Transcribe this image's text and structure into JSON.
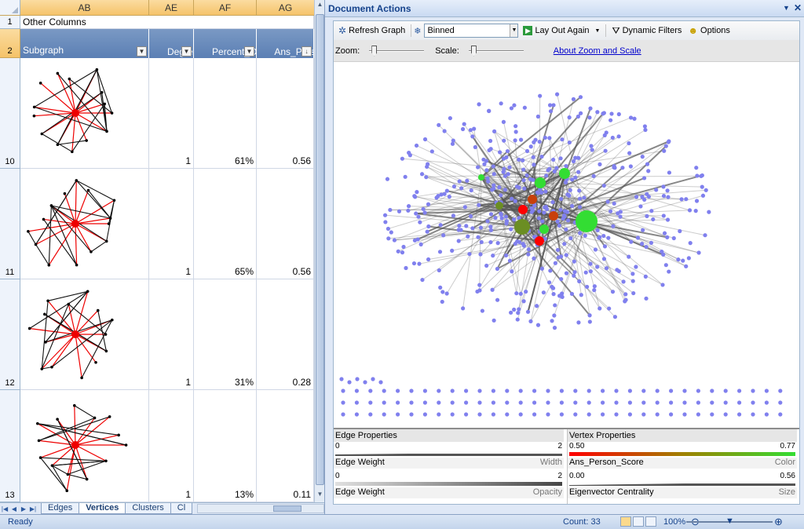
{
  "sheet": {
    "columns": [
      "AB",
      "AE",
      "AF",
      "AG"
    ],
    "row1": {
      "number": "1",
      "text": "Other Columns"
    },
    "row2": {
      "number": "2",
      "headers": [
        "Subgraph",
        "Degree_\nCutoff",
        "Percent_Out-\nDegree",
        "Ans_Person\n_Score"
      ]
    },
    "rows": [
      {
        "number": "10",
        "degree_cutoff": "1",
        "percent_out_degree": "61%",
        "ans_person_score": "0.56"
      },
      {
        "number": "11",
        "degree_cutoff": "1",
        "percent_out_degree": "65%",
        "ans_person_score": "0.56"
      },
      {
        "number": "12",
        "degree_cutoff": "1",
        "percent_out_degree": "31%",
        "ans_person_score": "0.28"
      },
      {
        "number": "13",
        "degree_cutoff": "1",
        "percent_out_degree": "13%",
        "ans_person_score": "0.11"
      }
    ],
    "tabs": [
      "Edges",
      "Vertices",
      "Clusters",
      "Cl"
    ],
    "active_tab": "Vertices"
  },
  "panel": {
    "title": "Document Actions",
    "toolbar": {
      "refresh": "Refresh Graph",
      "layout_value": "Binned",
      "layout_again": "Lay Out Again",
      "dynamic_filters": "Dynamic Filters",
      "options": "Options"
    },
    "zoom_label": "Zoom:",
    "scale_label": "Scale:",
    "zoom_scale_link": "About Zoom and Scale",
    "zoom_level": 0.05,
    "scale_level": 0.05
  },
  "legend": {
    "edge_header": "Edge Properties",
    "vertex_header": "Vertex Properties",
    "edge_rows": [
      {
        "min": "0",
        "max": "2",
        "name": "Edge Weight",
        "kind": "Width"
      },
      {
        "min": "0",
        "max": "2",
        "name": "Edge Weight",
        "kind": "Opacity"
      }
    ],
    "vertex_rows": [
      {
        "min": "0.50",
        "max": "0.77",
        "name": "Ans_Person_Score",
        "kind": "Color"
      },
      {
        "min": "0.00",
        "max": "0.56",
        "name": "Eigenvector Centrality",
        "kind": "Size"
      }
    ],
    "colors": {
      "vertex_low": "#ff0000",
      "vertex_high": "#33dd33",
      "vertex_default": "#8080ee",
      "edge": "#555555"
    }
  },
  "status": {
    "ready": "Ready",
    "count": "Count: 33",
    "zoom": "100%",
    "zoom_level": 0.5
  }
}
